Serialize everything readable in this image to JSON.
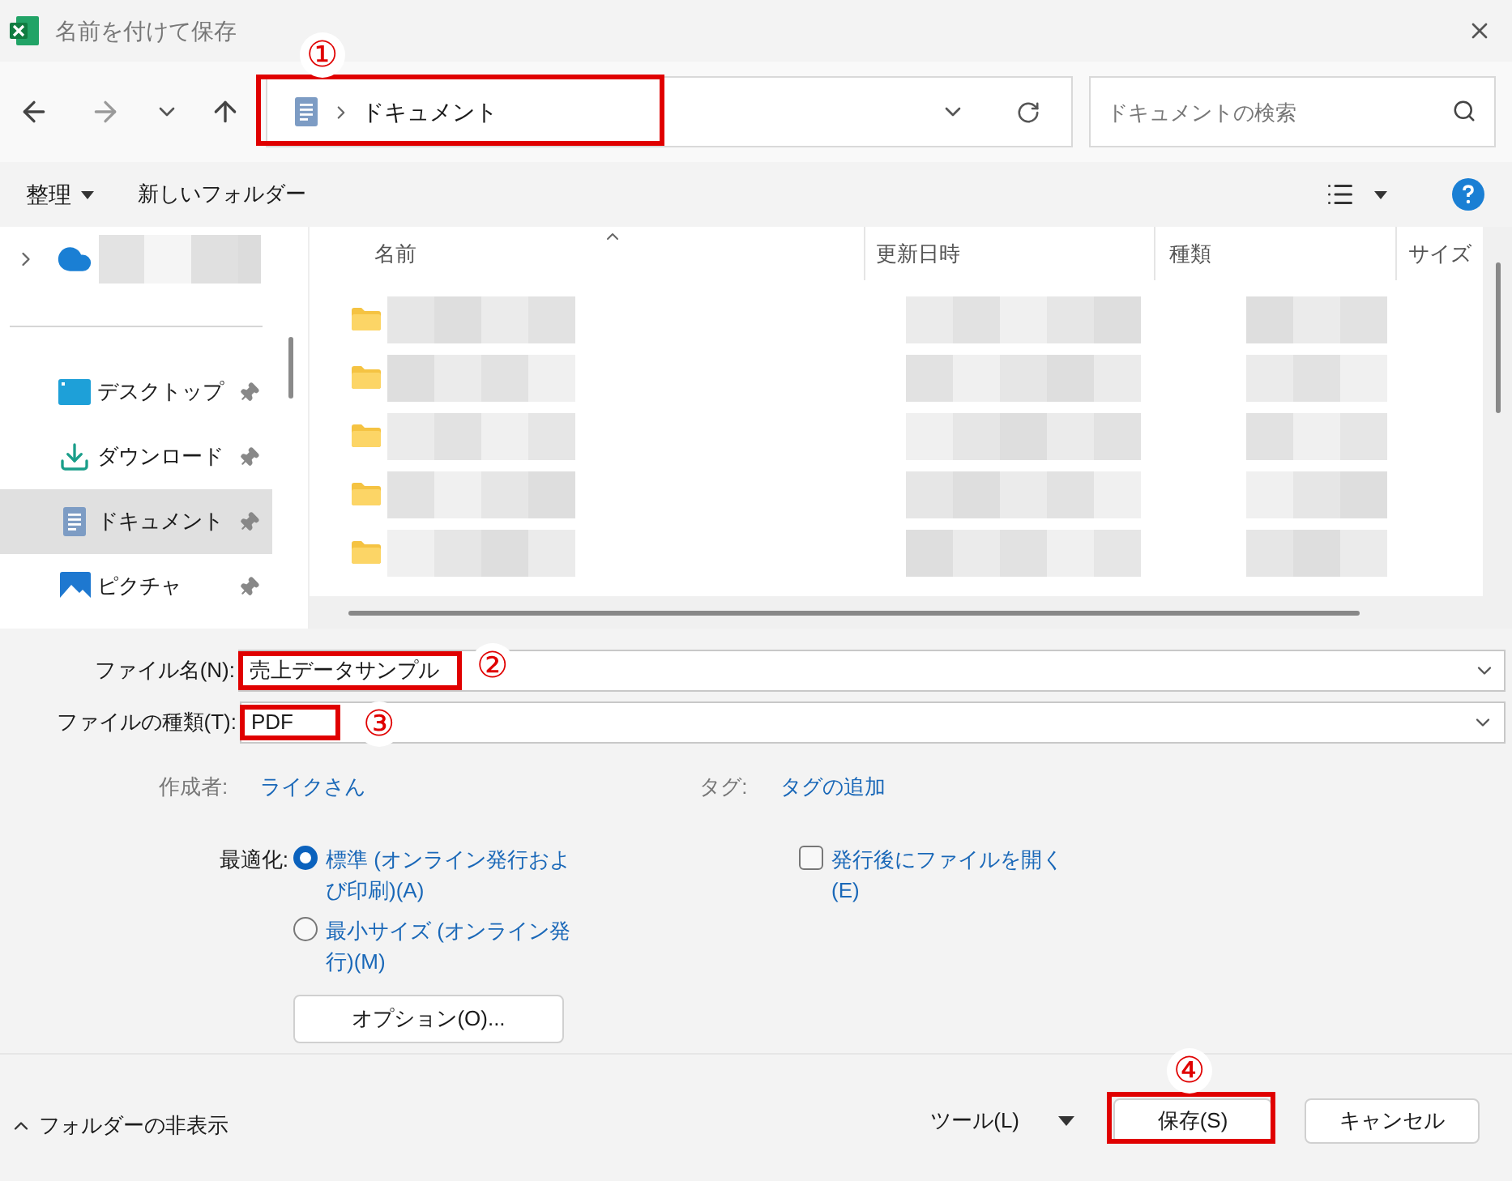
{
  "window": {
    "title": "名前を付けて保存"
  },
  "address": {
    "path": "ドキュメント",
    "search_placeholder": "ドキュメントの検索"
  },
  "toolbar": {
    "organize": "整理",
    "new_folder": "新しいフォルダー"
  },
  "sidebar": {
    "items": [
      {
        "kind": "desktop",
        "label": "デスクトップ",
        "selected": false
      },
      {
        "kind": "download",
        "label": "ダウンロード",
        "selected": false
      },
      {
        "kind": "document",
        "label": "ドキュメント",
        "selected": true
      },
      {
        "kind": "picture",
        "label": "ピクチャ",
        "selected": false
      }
    ]
  },
  "table": {
    "columns": [
      "名前",
      "更新日時",
      "種類",
      "サイズ"
    ],
    "rows": [
      {
        "kind": "folder"
      },
      {
        "kind": "folder"
      },
      {
        "kind": "folder"
      },
      {
        "kind": "folder"
      },
      {
        "kind": "folder"
      }
    ]
  },
  "form": {
    "file_name_label": "ファイル名(N):",
    "file_name": "売上データサンプル",
    "file_type_label": "ファイルの種類(T):",
    "file_type": "PDF",
    "author_label": "作成者:",
    "author": "ライクさん",
    "tags_label": "タグ:",
    "tags": "タグの追加",
    "optimize_label": "最適化:",
    "options": [
      {
        "label": "標準 (オンライン発行および印刷)(A)",
        "selected": true
      },
      {
        "label": "最小サイズ (オンライン発行)(M)",
        "selected": false
      }
    ],
    "open_after": {
      "label": "発行後にファイルを開く (E)",
      "checked": false
    },
    "options_button": "オプション(O)..."
  },
  "footer": {
    "hide_folders": "フォルダーの非表示",
    "tools": "ツール(L)",
    "save": "保存(S)",
    "cancel": "キャンセル"
  },
  "annotations": [
    {
      "label": "①"
    },
    {
      "label": "②"
    },
    {
      "label": "③"
    },
    {
      "label": "④"
    }
  ]
}
